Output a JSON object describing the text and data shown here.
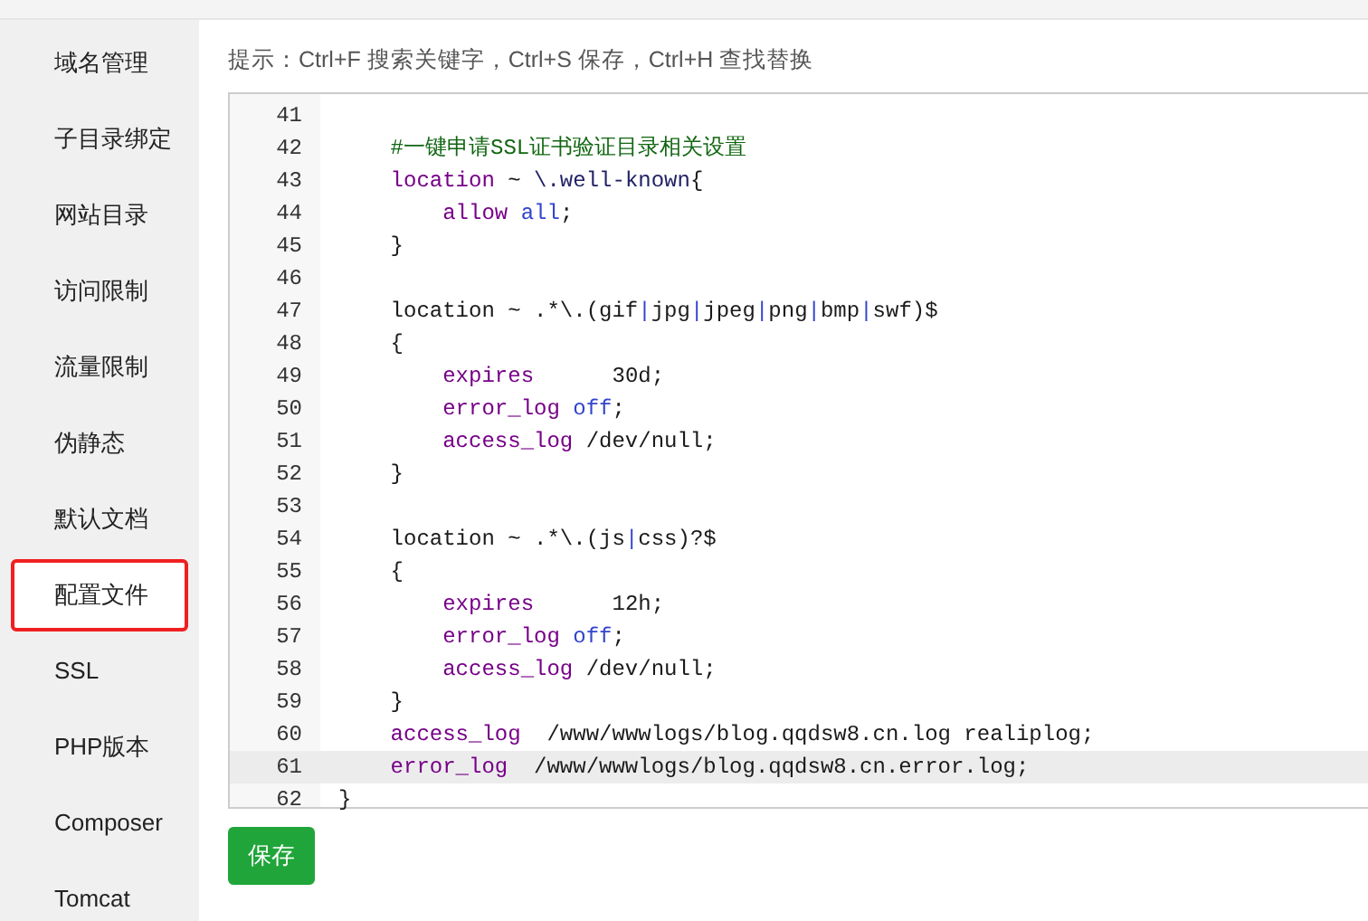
{
  "sidebar": {
    "items": [
      {
        "label": "域名管理",
        "selected": false
      },
      {
        "label": "子目录绑定",
        "selected": false
      },
      {
        "label": "网站目录",
        "selected": false
      },
      {
        "label": "访问限制",
        "selected": false
      },
      {
        "label": "流量限制",
        "selected": false
      },
      {
        "label": "伪静态",
        "selected": false
      },
      {
        "label": "默认文档",
        "selected": false
      },
      {
        "label": "配置文件",
        "selected": true
      },
      {
        "label": "SSL",
        "selected": false
      },
      {
        "label": "PHP版本",
        "selected": false
      },
      {
        "label": "Composer",
        "selected": false
      },
      {
        "label": "Tomcat",
        "selected": false
      }
    ]
  },
  "hint": "提示：Ctrl+F 搜索关键字，Ctrl+S 保存，Ctrl+H 查找替换",
  "editor": {
    "lines": [
      {
        "number": "41",
        "active": false
      },
      {
        "number": "42",
        "active": false,
        "tokens": [
          {
            "kind": "comment",
            "text": "    #一键申请SSL证书验证目录相关设置"
          }
        ]
      },
      {
        "number": "43",
        "active": false,
        "tokens": [
          {
            "kind": "keyword",
            "text": "    location"
          },
          {
            "kind": "plain",
            "text": " ~ "
          },
          {
            "kind": "string",
            "text": "\\.well-known"
          },
          {
            "kind": "plain",
            "text": "{"
          }
        ]
      },
      {
        "number": "44",
        "active": false,
        "tokens": [
          {
            "kind": "keyword",
            "text": "        allow"
          },
          {
            "kind": "atom",
            "text": " all"
          },
          {
            "kind": "plain",
            "text": ";"
          }
        ]
      },
      {
        "number": "45",
        "active": false,
        "tokens": [
          {
            "kind": "plain",
            "text": "    }"
          }
        ]
      },
      {
        "number": "46",
        "active": false
      },
      {
        "number": "47",
        "active": false,
        "tokens": [
          {
            "kind": "plain",
            "text": "    location ~ .*\\.(gif"
          },
          {
            "kind": "atom",
            "text": "|"
          },
          {
            "kind": "plain",
            "text": "jpg"
          },
          {
            "kind": "atom",
            "text": "|"
          },
          {
            "kind": "plain",
            "text": "jpeg"
          },
          {
            "kind": "atom",
            "text": "|"
          },
          {
            "kind": "plain",
            "text": "png"
          },
          {
            "kind": "atom",
            "text": "|"
          },
          {
            "kind": "plain",
            "text": "bmp"
          },
          {
            "kind": "atom",
            "text": "|"
          },
          {
            "kind": "plain",
            "text": "swf)$"
          }
        ]
      },
      {
        "number": "48",
        "active": false,
        "tokens": [
          {
            "kind": "plain",
            "text": "    {"
          }
        ]
      },
      {
        "number": "49",
        "active": false,
        "tokens": [
          {
            "kind": "keyword",
            "text": "        expires"
          },
          {
            "kind": "plain",
            "text": "      30d;"
          }
        ]
      },
      {
        "number": "50",
        "active": false,
        "tokens": [
          {
            "kind": "keyword",
            "text": "        error_log"
          },
          {
            "kind": "atom",
            "text": " off"
          },
          {
            "kind": "plain",
            "text": ";"
          }
        ]
      },
      {
        "number": "51",
        "active": false,
        "tokens": [
          {
            "kind": "keyword",
            "text": "        access_log"
          },
          {
            "kind": "plain",
            "text": " /dev/null;"
          }
        ]
      },
      {
        "number": "52",
        "active": false,
        "tokens": [
          {
            "kind": "plain",
            "text": "    }"
          }
        ]
      },
      {
        "number": "53",
        "active": false
      },
      {
        "number": "54",
        "active": false,
        "tokens": [
          {
            "kind": "plain",
            "text": "    location ~ .*\\.(js"
          },
          {
            "kind": "atom",
            "text": "|"
          },
          {
            "kind": "plain",
            "text": "css)?$"
          }
        ]
      },
      {
        "number": "55",
        "active": false,
        "tokens": [
          {
            "kind": "plain",
            "text": "    {"
          }
        ]
      },
      {
        "number": "56",
        "active": false,
        "tokens": [
          {
            "kind": "keyword",
            "text": "        expires"
          },
          {
            "kind": "plain",
            "text": "      12h;"
          }
        ]
      },
      {
        "number": "57",
        "active": false,
        "tokens": [
          {
            "kind": "keyword",
            "text": "        error_log"
          },
          {
            "kind": "atom",
            "text": " off"
          },
          {
            "kind": "plain",
            "text": ";"
          }
        ]
      },
      {
        "number": "58",
        "active": false,
        "tokens": [
          {
            "kind": "keyword",
            "text": "        access_log"
          },
          {
            "kind": "plain",
            "text": " /dev/null;"
          }
        ]
      },
      {
        "number": "59",
        "active": false,
        "tokens": [
          {
            "kind": "plain",
            "text": "    }"
          }
        ]
      },
      {
        "number": "60",
        "active": false,
        "tokens": [
          {
            "kind": "keyword",
            "text": "    access_log"
          },
          {
            "kind": "plain",
            "text": "  /www/wwwlogs/blog.qqdsw8.cn.log realiplog;"
          }
        ]
      },
      {
        "number": "61",
        "active": true,
        "tokens": [
          {
            "kind": "keyword",
            "text": "    error_log"
          },
          {
            "kind": "plain",
            "text": "  /www/wwwlogs/blog.qqdsw8.cn.error.log;"
          }
        ]
      },
      {
        "number": "62",
        "active": false,
        "tokens": [
          {
            "kind": "plain",
            "text": "}"
          }
        ]
      }
    ]
  },
  "save_button": "保存"
}
